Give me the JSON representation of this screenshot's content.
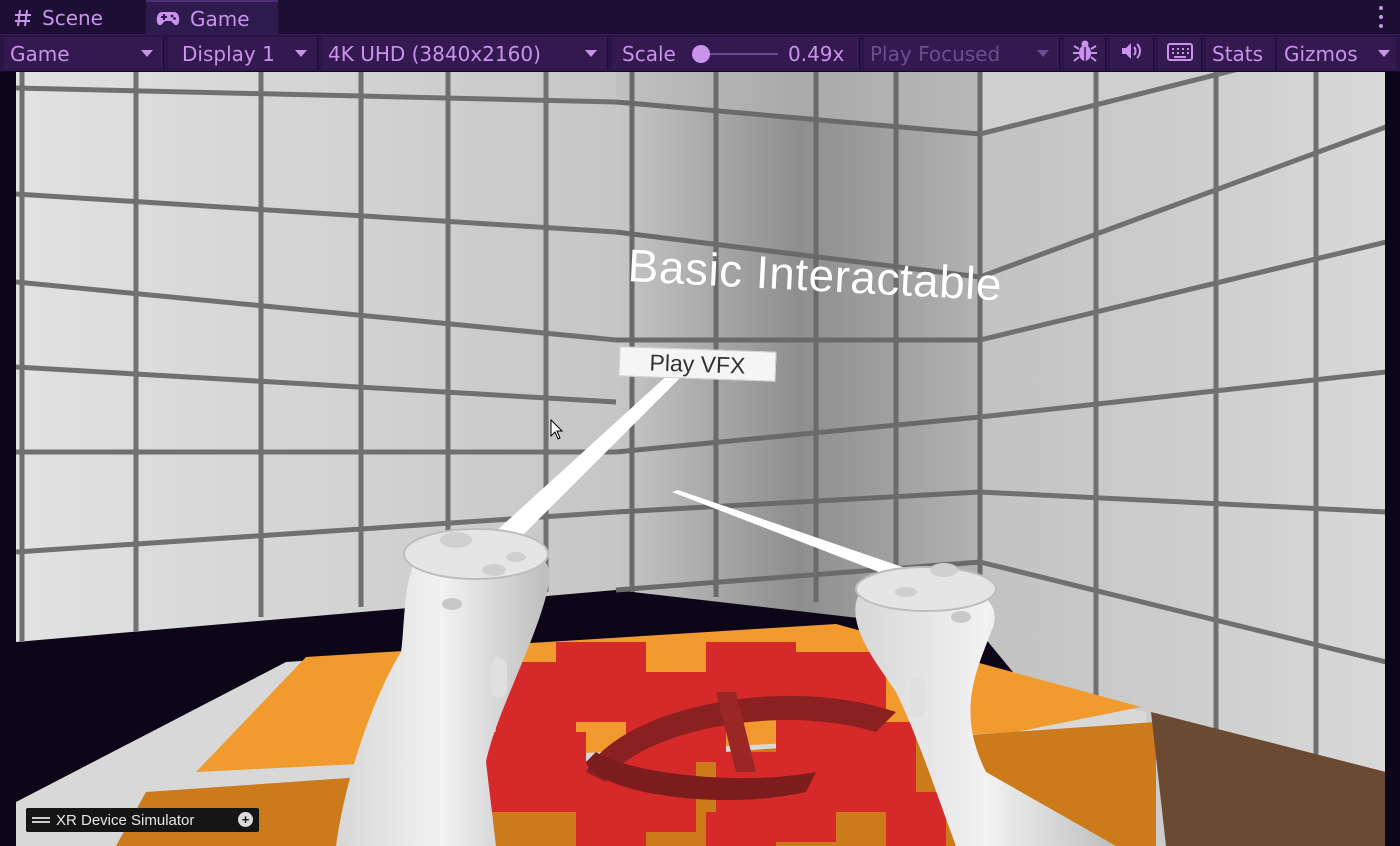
{
  "tabs": {
    "scene_label": "Scene",
    "game_label": "Game",
    "active": "Game"
  },
  "toolbar": {
    "view_mode": "Game",
    "display": "Display 1",
    "resolution": "4K UHD (3840x2160)",
    "scale_label": "Scale",
    "scale_value": "0.49x",
    "play_mode": "Play Focused",
    "stats_label": "Stats",
    "gizmos_label": "Gizmos"
  },
  "scene": {
    "title": "Basic Interactable",
    "button_label": "Play VFX",
    "simulator_label": "XR Device Simulator"
  },
  "colors": {
    "editor_bg": "#1d0f33",
    "toolbar_bg": "#2a1646",
    "accent_text": "#c993ec",
    "disabled_text": "#6d4d8e",
    "table_orange": "#f19a2e",
    "vfx_red": "#d62a2a"
  },
  "icons": {
    "scene_tab": "hash-icon",
    "game_tab": "gamepad-icon",
    "debug": "bug-icon",
    "audio": "speaker-icon",
    "keyboard": "keyboard-icon",
    "menu": "kebab-menu-icon"
  }
}
